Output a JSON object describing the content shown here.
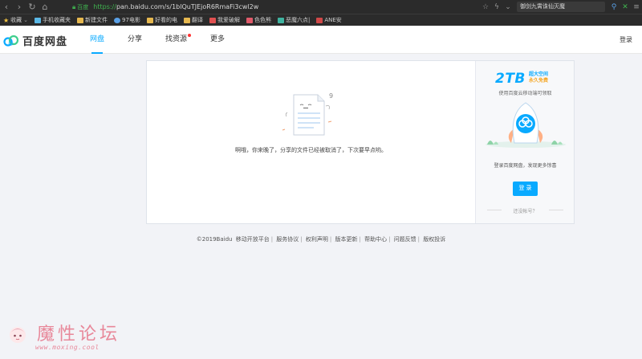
{
  "browser": {
    "secure_label": "百度",
    "url_scheme": "https://",
    "url_rest": "pan.baidu.com/s/1blQuTJEjoR6RmaFi3cwl2w",
    "search_text": "御剑九霄诛仙灭魔"
  },
  "bookmarks": [
    {
      "label": "收藏",
      "icon": "star-icon"
    },
    {
      "label": "手机收藏夹",
      "icon": "phone-icon"
    },
    {
      "label": "新建文件",
      "icon": "folder-icon"
    },
    {
      "label": "97电影",
      "icon": "headphone-icon"
    },
    {
      "label": "好看的电",
      "icon": "folder-icon"
    },
    {
      "label": "翻译",
      "icon": "folder-icon"
    },
    {
      "label": "我爱破解",
      "icon": "grid-icon"
    },
    {
      "label": "色色熊",
      "icon": "heart-icon"
    },
    {
      "label": "恶魔六点|",
      "icon": "gift-icon"
    },
    {
      "label": "ANE安",
      "icon": "ane-icon"
    }
  ],
  "header": {
    "logo_text": "百度网盘",
    "nav": [
      {
        "label": "网盘",
        "active": true
      },
      {
        "label": "分享",
        "active": false
      },
      {
        "label": "找资源",
        "active": false,
        "dot": true
      },
      {
        "label": "更多",
        "active": false
      }
    ],
    "login_label": "登录"
  },
  "main": {
    "message": "啊哦，你来晚了，分享的文件已经被取消了，下次要早点哟。"
  },
  "promo": {
    "big": "2TB",
    "tag_line1": "超大空间",
    "tag_line2": "永久免费",
    "subtitle": "使用百度云移动端可领取",
    "login_prompt": "登录百度网盘，发现更多惊喜",
    "login_button": "登 录",
    "register": "还没帐号？"
  },
  "footer": {
    "items": [
      "©2019Baidu",
      "移动开放平台",
      "服务协议",
      "权利声明",
      "版本更新",
      "帮助中心",
      "问题反馈",
      "版权投诉"
    ]
  },
  "watermark": {
    "title": "魔性论坛",
    "url": "www.moxing.cool"
  },
  "colors": {
    "accent": "#09aaff",
    "page_bg": "#f2f3f7",
    "chrome_bg": "#2b2b2b"
  }
}
